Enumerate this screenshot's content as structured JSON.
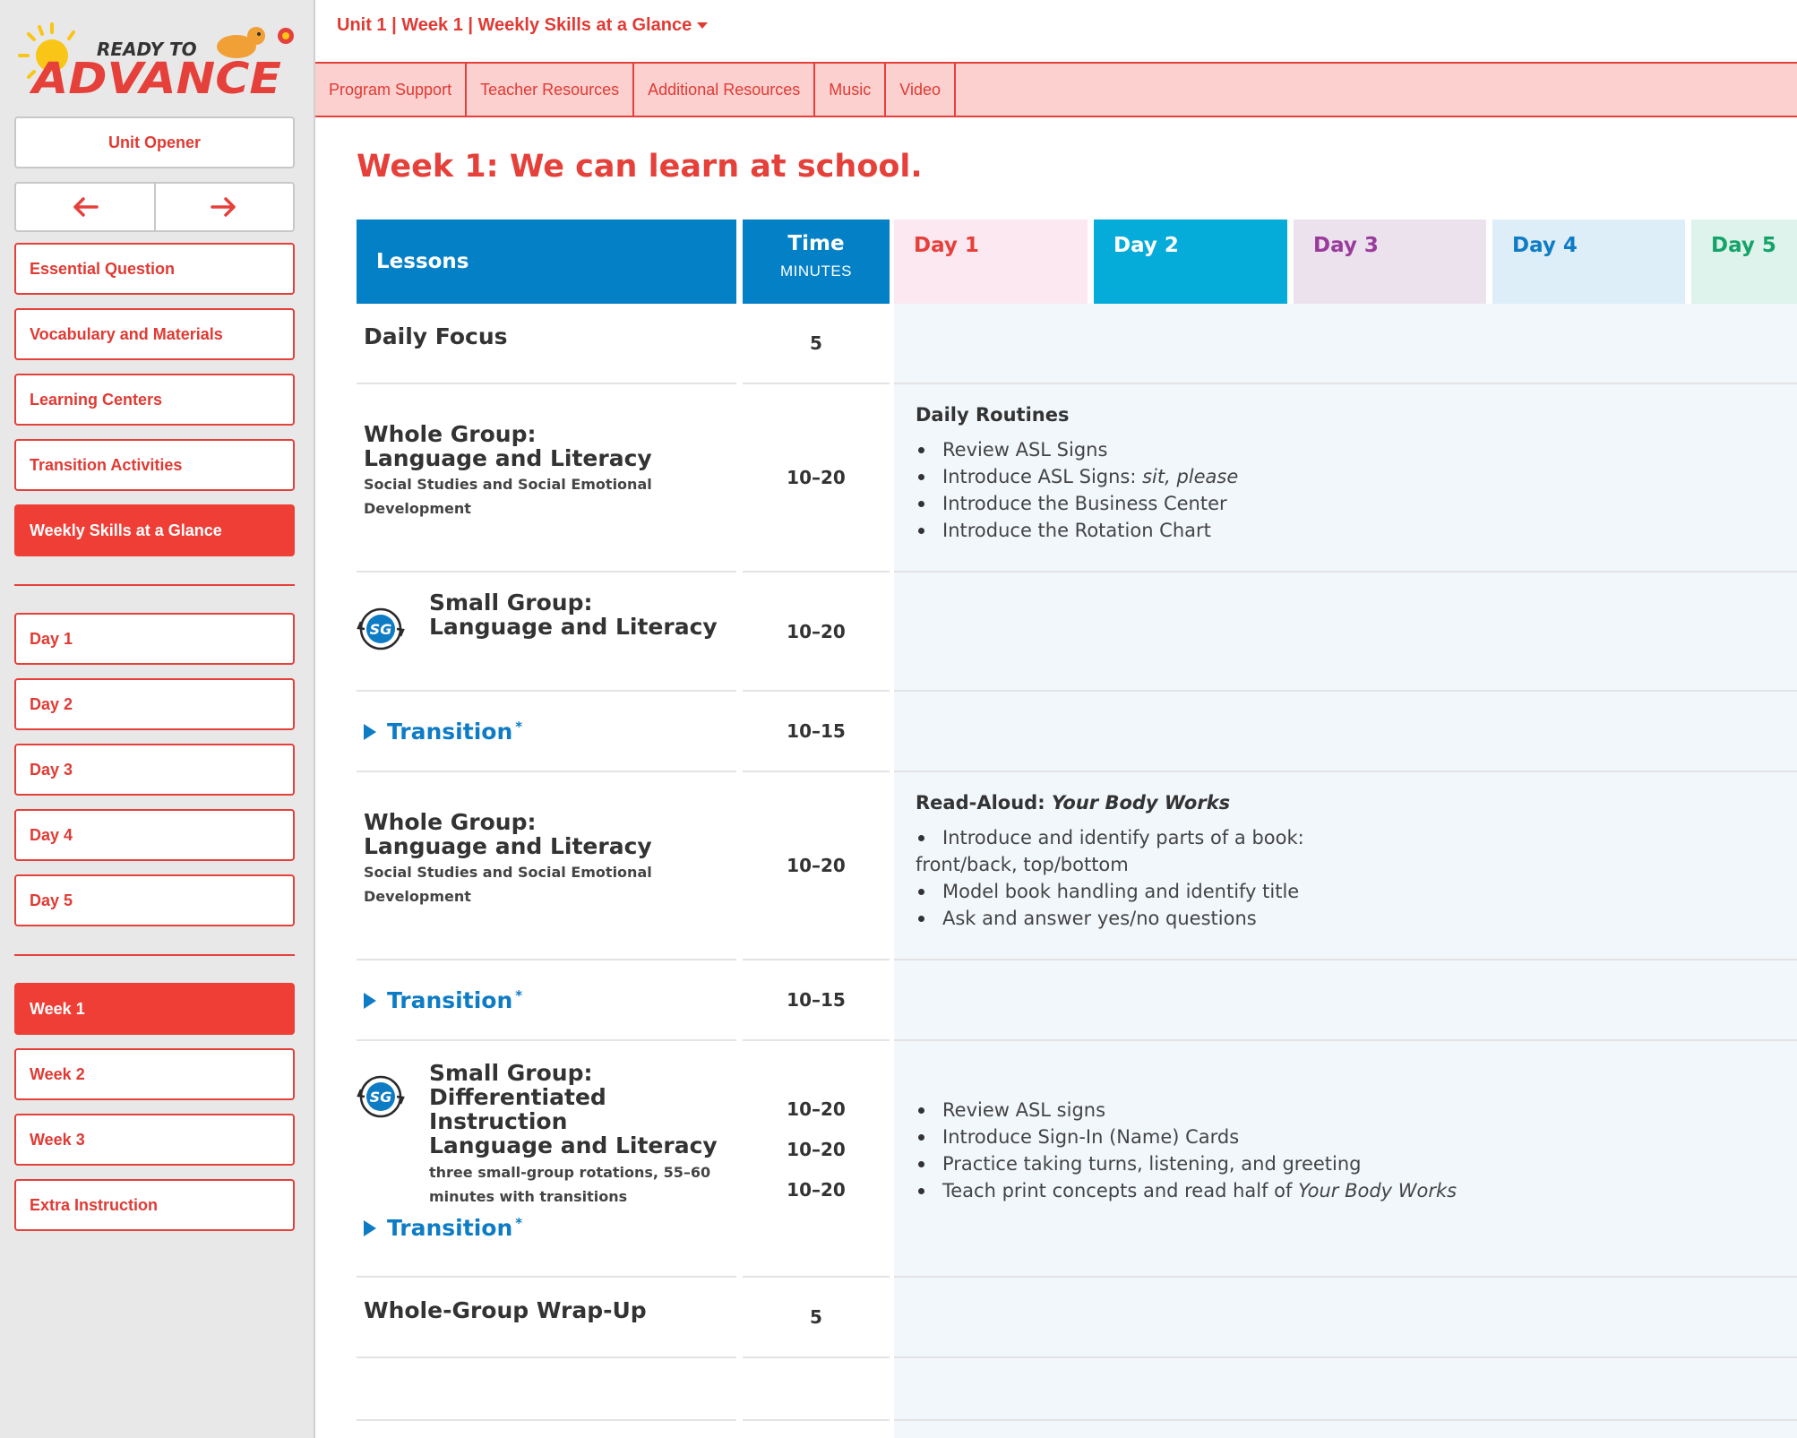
{
  "sidebar": {
    "logo": {
      "line1": "READY TO",
      "line2": "ADVANCE"
    },
    "unit_opener": "Unit Opener",
    "nav_items": [
      {
        "label": "Essential Question"
      },
      {
        "label": "Vocabulary and Materials"
      },
      {
        "label": "Learning Centers"
      },
      {
        "label": "Transition Activities"
      },
      {
        "label": "Weekly Skills at a Glance",
        "active": true
      }
    ],
    "days": [
      "Day 1",
      "Day 2",
      "Day 3",
      "Day 4",
      "Day 5"
    ],
    "weeks": [
      {
        "label": "Week 1",
        "active": true
      },
      {
        "label": "Week 2"
      },
      {
        "label": "Week 3"
      },
      {
        "label": "Extra Instruction"
      }
    ]
  },
  "breadcrumb": "Unit 1 | Week 1 | Weekly Skills at a Glance",
  "tabs": [
    "Program Support",
    "Teacher Resources",
    "Additional Resources",
    "Music",
    "Video"
  ],
  "page_title": "Week 1: We can learn at school.",
  "table": {
    "header": {
      "lessons": "Lessons",
      "time": "Time",
      "time_unit": "MINUTES",
      "days": [
        {
          "label": "Day 1",
          "bg": "#fce8f1",
          "color": "#e5403a"
        },
        {
          "label": "Day 2",
          "bg": "#05acd9",
          "color": "#ffffff"
        },
        {
          "label": "Day 3",
          "bg": "#ebe2ee",
          "color": "#9a3b9c"
        },
        {
          "label": "Day 4",
          "bg": "#deeef9",
          "color": "#0e7cc5"
        },
        {
          "label": "Day 5",
          "bg": "#def3ec",
          "color": "#15a36a"
        }
      ]
    },
    "rows": {
      "daily_focus": {
        "title": "Daily Focus",
        "time": "5"
      },
      "whole_group_1": {
        "title_line1": "Whole Group:",
        "title_line2": "Language and Literacy",
        "sub_line1": "Social Studies and Social Emotional",
        "sub_line2": "Development",
        "time": "10–20",
        "day_title": "Daily Routines",
        "bullets": [
          "Review ASL Signs",
          "Introduce ASL Signs: ",
          "Introduce the Business Center",
          "Introduce the Rotation Chart"
        ],
        "bullet2_italic": "sit, please"
      },
      "small_group_1": {
        "icon_label": "SG",
        "title_line1": "Small Group:",
        "title_line2": "Language and Literacy",
        "time": "10–20"
      },
      "transition_1": {
        "label": "Transition",
        "mark": "*",
        "time": "10–15"
      },
      "whole_group_2": {
        "title_line1": "Whole Group:",
        "title_line2": "Language and Literacy",
        "sub_line1": "Social Studies and Social Emotional",
        "sub_line2": "Development",
        "time": "10–20",
        "day_title_prefix": "Read-Aloud: ",
        "day_title_italic": "Your Body Works",
        "bullet1": "Introduce and identify parts of a book:",
        "bullet1_cont": "front/back, top/bottom",
        "bullets": [
          "Model book handling and identify title",
          "Ask and answer yes/no questions"
        ]
      },
      "transition_2": {
        "label": "Transition",
        "mark": "*",
        "time": "10–15"
      },
      "small_group_2": {
        "icon_label": "SG",
        "title_line1": "Small Group:",
        "title_line2": "Differentiated",
        "title_line3": "Instruction",
        "title_line4": "Language and Literacy",
        "sub_line1": "three small-group rotations, 55–60",
        "sub_line2": "minutes with transitions",
        "transition_label": "Transition",
        "transition_mark": "*",
        "times": [
          "10–20",
          "10–20",
          "10–20"
        ],
        "bullets": [
          "Review ASL signs",
          "Introduce Sign-In (Name) Cards",
          "Practice taking turns, listening, and greeting",
          "Teach print concepts and read half of "
        ],
        "bullet4_italic": "Your Body Works"
      },
      "wrap_up": {
        "title": "Whole-Group Wrap-Up",
        "time": "5"
      }
    }
  },
  "colors": {
    "brand_red": "#e5403a",
    "brand_blue": "#0480c7",
    "tab_bg": "#fbd0cf",
    "cell_bg": "#f2f7fc"
  }
}
